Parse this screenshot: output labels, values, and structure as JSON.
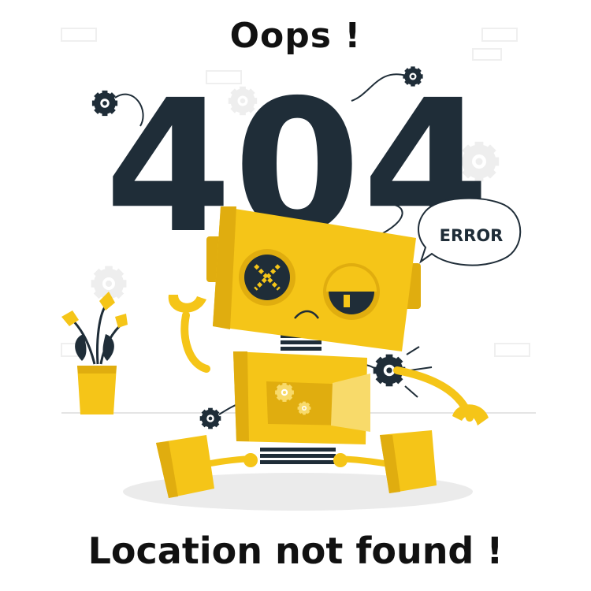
{
  "headline": "Oops !",
  "error_code": "404",
  "speech_bubble": "ERROR",
  "subtitle": "Location not found !",
  "colors": {
    "accent_yellow": "#F5C518",
    "dark_navy": "#1F2D38",
    "light_gray": "#EBEBEB",
    "background": "#FFFFFF"
  },
  "icons": [
    "gear-icon",
    "robot-illustration",
    "flower-pot-illustration",
    "speech-bubble"
  ]
}
